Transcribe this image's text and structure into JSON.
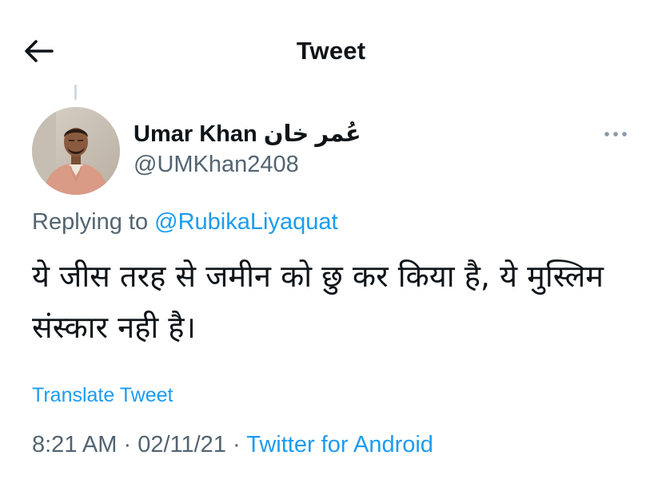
{
  "header": {
    "title": "Tweet",
    "back_icon": "arrow-left-icon"
  },
  "tweet": {
    "author": {
      "display_name": "Umar Khan عُمر خان",
      "handle": "@UMKhan2408",
      "avatar": "avatar-photo"
    },
    "more_icon": "ellipsis-icon",
    "reply_context": {
      "prefix": "Replying to",
      "mention": "@RubikaLiyaquat"
    },
    "text": "ये जीस तरह से जमीन को छु कर किया है, ये मुस्लिम संस्कार नही है।",
    "translate_label": "Translate Tweet",
    "time": "8:21 AM",
    "separator": "·",
    "date": "02/11/21",
    "source": "Twitter for Android"
  },
  "colors": {
    "text_primary": "#0f1419",
    "text_secondary": "#536471",
    "link": "#1d9bf0"
  }
}
